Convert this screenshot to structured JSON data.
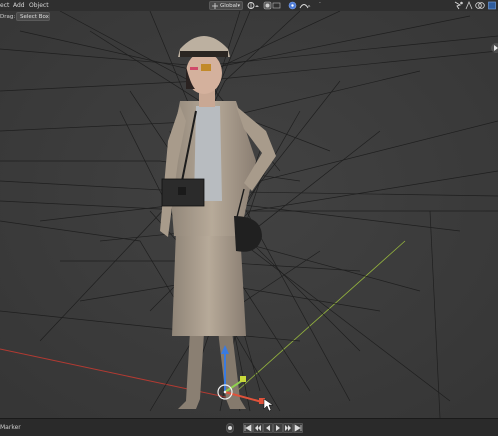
{
  "header": {
    "menu": [
      "ect",
      "Add",
      "Object"
    ],
    "mode_label": "Global",
    "icons": [
      "cursor-icon",
      "move-icon",
      "pivot-icon",
      "snap-icon",
      "proportional-icon",
      "overlay-icon",
      "shading-icon"
    ]
  },
  "toolbar": {
    "drag_label": "Drag:",
    "select_box_label": "Select Box"
  },
  "timeline": {
    "marker_label": "Marker"
  },
  "colors": {
    "header_bg": "#2f2f2f",
    "viewport_bg": "#3d3d3d",
    "x_axis": "#c0392b",
    "y_axis": "#8fb23a",
    "gizmo_z": "#3a7be0",
    "gizmo_y": "#8fd14f",
    "gizmo_x": "#e0523a"
  }
}
